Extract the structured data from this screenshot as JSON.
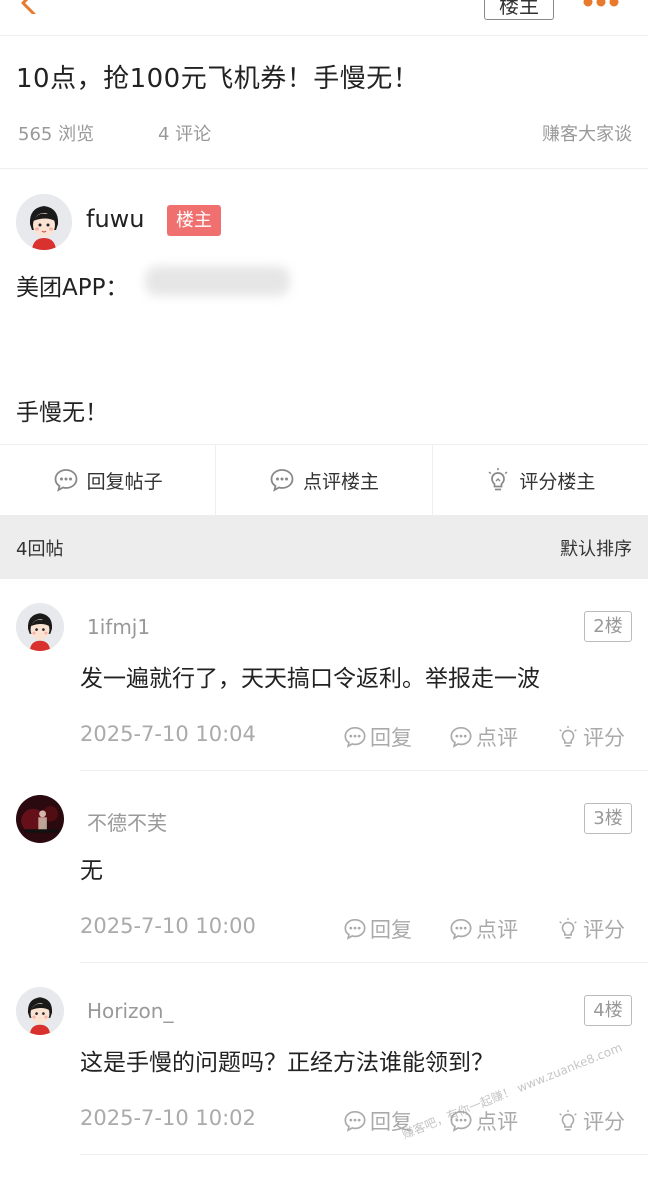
{
  "header": {
    "op_label": "楼主"
  },
  "post": {
    "title": "10点，抢100元飞机券！手慢无！",
    "views": "565 浏览",
    "comments": "4 评论",
    "board": "赚客大家谈",
    "author": "fuwu",
    "author_badge": "楼主",
    "content_line1": "美团APP：",
    "content_line2": "手慢无！"
  },
  "actions": [
    {
      "label": "回复帖子",
      "icon": "comment-bubble-icon"
    },
    {
      "label": "点评楼主",
      "icon": "comment-bubble-icon"
    },
    {
      "label": "评分楼主",
      "icon": "lightbulb-icon"
    }
  ],
  "reply_header": {
    "count": "4回帖",
    "sort": "默认排序"
  },
  "replies": [
    {
      "user": "1ifmj1",
      "floor": "2楼",
      "text": "发一遍就行了，天天搞口令返利。举报走一波",
      "time": "2025-7-10 10:04",
      "avatar": "cartoon-girl"
    },
    {
      "user": "不德不芙",
      "floor": "3楼",
      "text": "无",
      "time": "2025-7-10 10:00",
      "avatar": "dark-photo"
    },
    {
      "user": "Horizon_",
      "floor": "4楼",
      "text": "这是手慢的问题吗？正经方法谁能领到？",
      "time": "2025-7-10 10:02",
      "avatar": "cartoon-girl"
    }
  ],
  "reply_actions": {
    "reply": "回复",
    "comment": "点评",
    "rate": "评分"
  },
  "watermark": "赚客吧，有你一起赚！ www.zuanke8.com",
  "colors": {
    "accent": "#e87a2e",
    "op_badge": "#f07070"
  }
}
